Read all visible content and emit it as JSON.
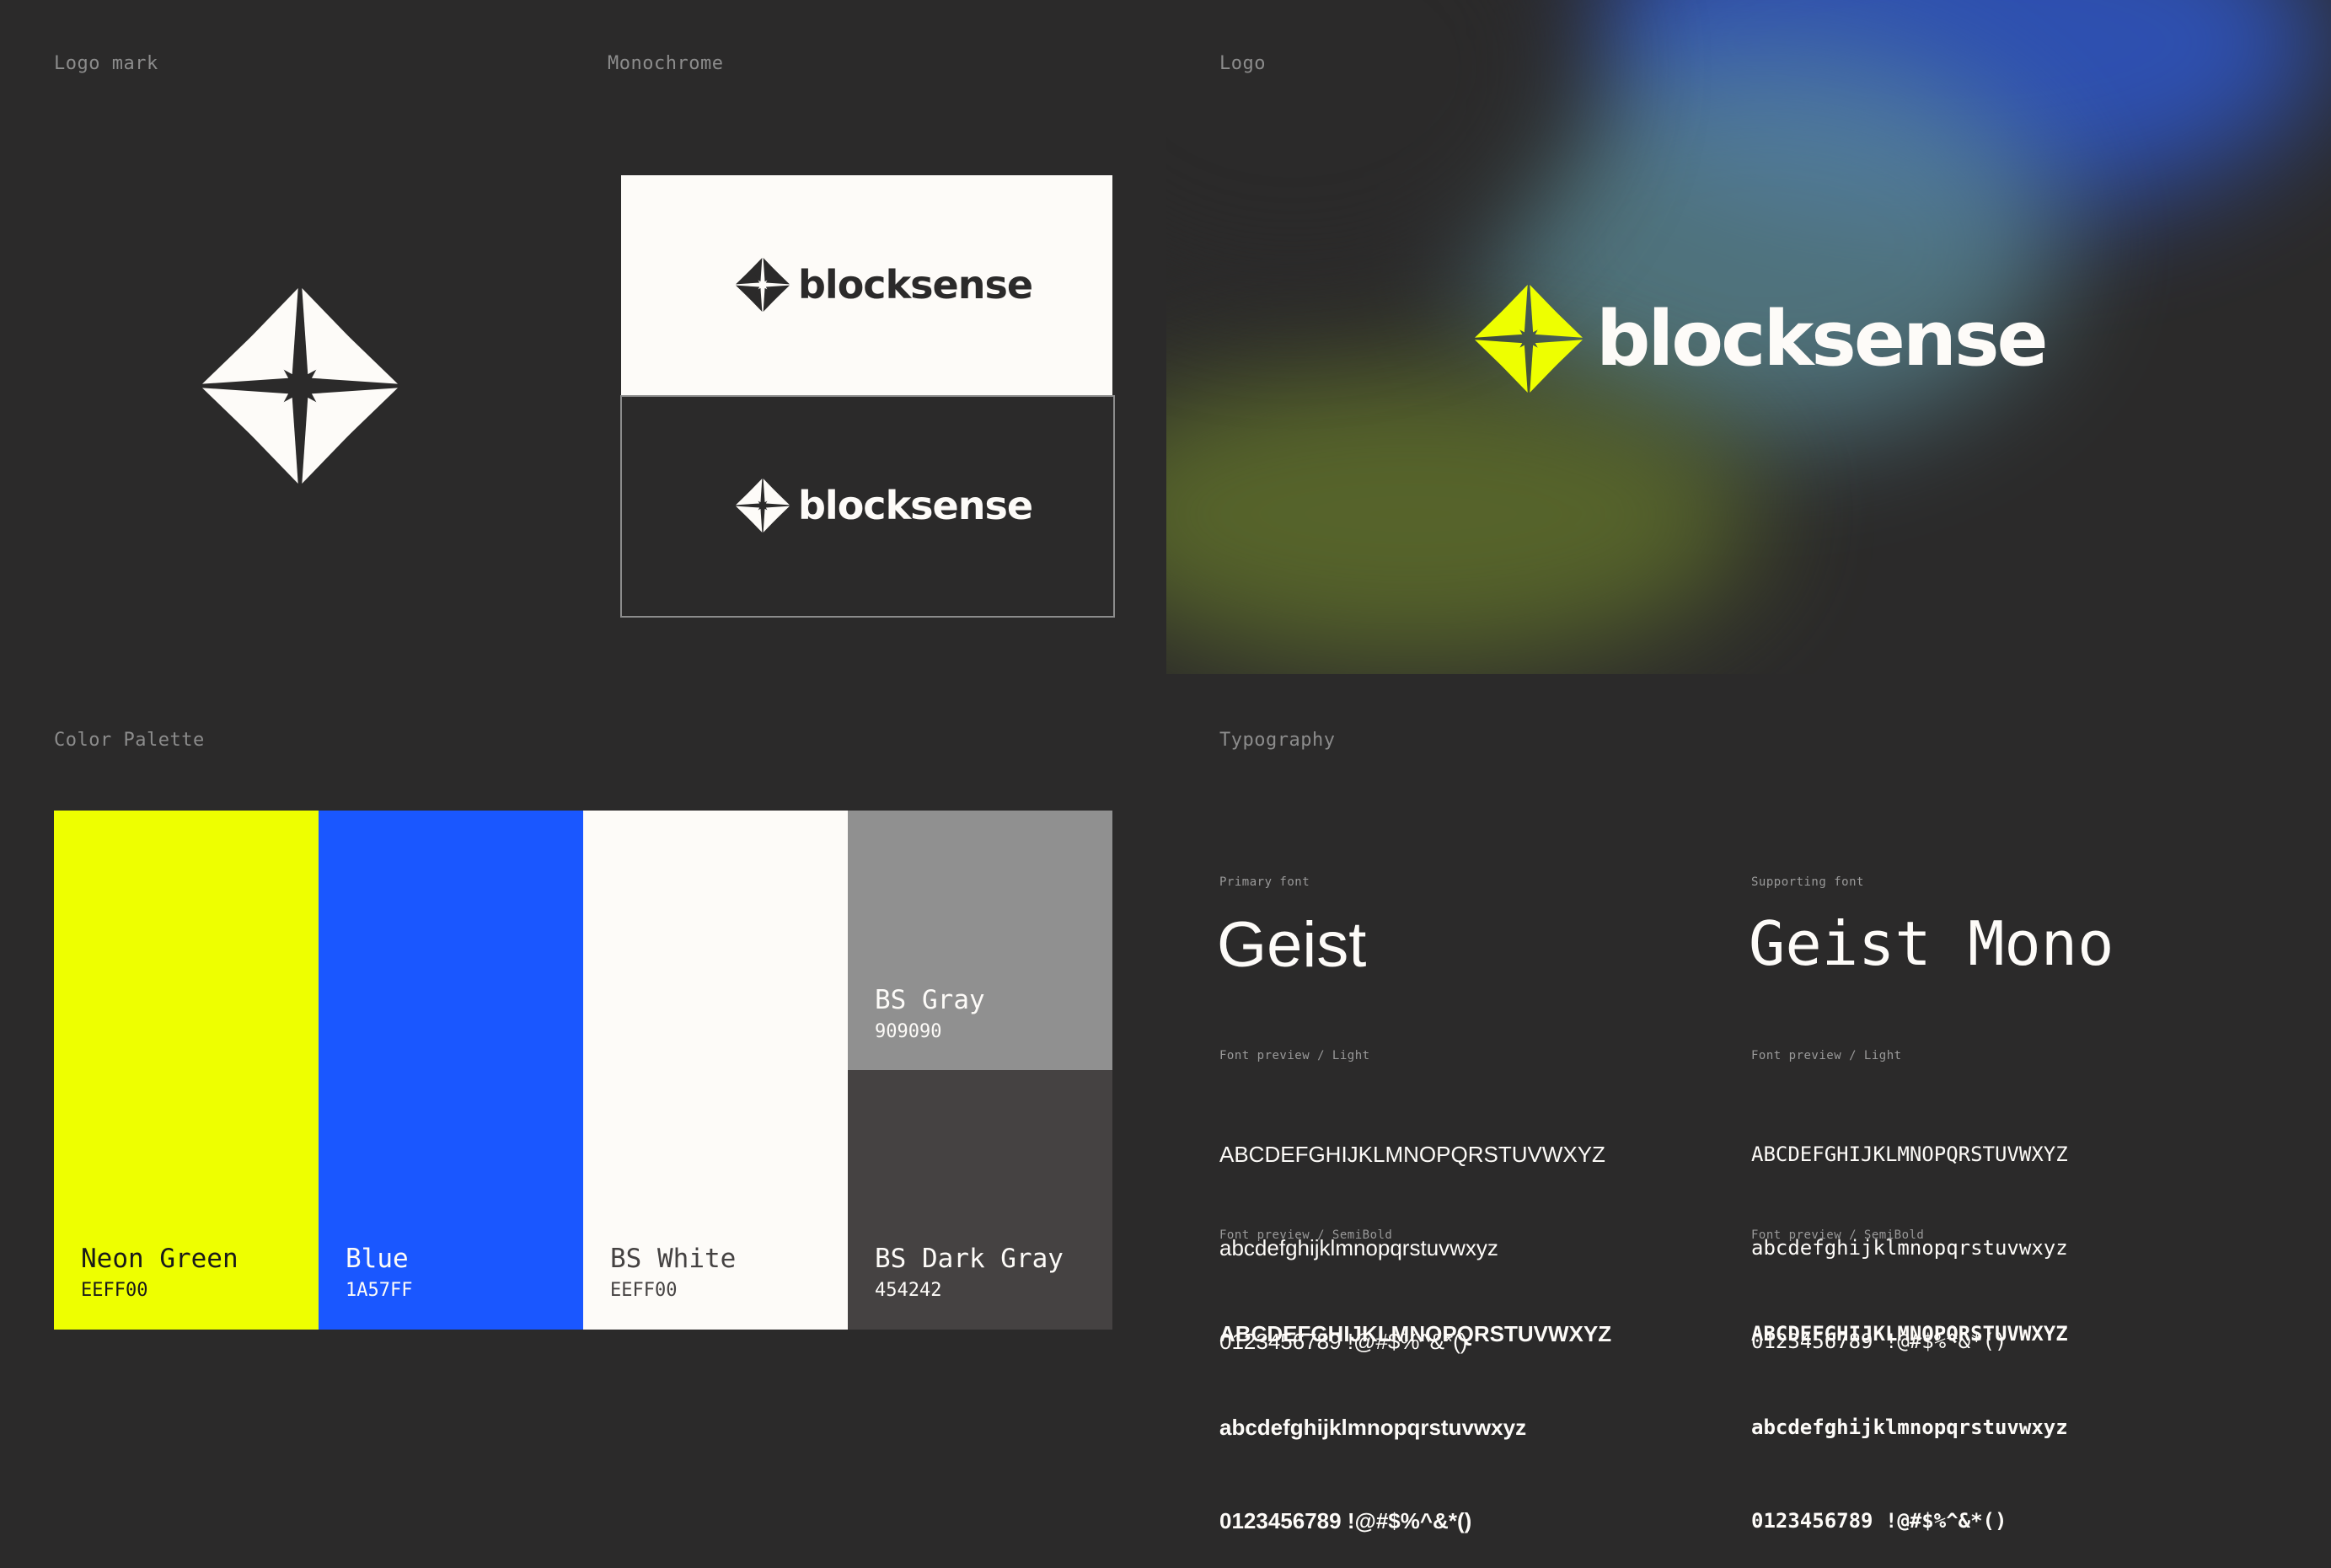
{
  "sections": {
    "logo_mark": "Logo mark",
    "monochrome": "Monochrome",
    "logo": "Logo",
    "color_palette": "Color Palette",
    "typography": "Typography"
  },
  "brand": {
    "wordmark": "blocksense"
  },
  "colors_accent": {
    "neon": "#EEFF00",
    "blue": "#1A57FF"
  },
  "palette": [
    {
      "name": "Neon Green",
      "hex": "EEFF00",
      "color": "#EEFF00",
      "text_color": "#1a1a1a"
    },
    {
      "name": "Blue",
      "hex": "1A57FF",
      "color": "#1A57FF",
      "text_color": "#fdfbf8"
    },
    {
      "name": "BS White",
      "hex": "EEFF00",
      "color": "#FDFBF8",
      "text_color": "#454242"
    },
    {
      "name": "BS Gray",
      "hex": "909090",
      "color": "#909090",
      "text_color": "#fdfbf8"
    },
    {
      "name": "BS Dark Gray",
      "hex": "454242",
      "color": "#454242",
      "text_color": "#fdfbf8"
    }
  ],
  "typography": {
    "primary": {
      "label": "Primary font",
      "name": "Geist",
      "preview_light_label": "Font preview / Light",
      "preview_light": [
        "ABCDEFGHIJKLMNOPQRSTUVWXYZ",
        "abcdefghijklmnopqrstuvwxyz",
        "0123456789 !@#$%^&*()"
      ],
      "preview_semibold_label": "Font preview / SemiBold",
      "preview_semibold": [
        "ABCDEFGHIJKLMNOPQRSTUVWXYZ",
        "abcdefghijklmnopqrstuvwxyz",
        "0123456789 !@#$%^&*()"
      ]
    },
    "supporting": {
      "label": "Supporting font",
      "name": "Geist Mono",
      "preview_light_label": "Font preview / Light",
      "preview_light": [
        "ABCDEFGHIJKLMNOPQRSTUVWXYZ",
        "abcdefghijklmnopqrstuvwxyz",
        "0123456789 !@#$%^&*()"
      ],
      "preview_semibold_label": "Font preview / SemiBold",
      "preview_semibold": [
        "ABCDEFGHIJKLMNOPQRSTUVWXYZ",
        "abcdefghijklmnopqrstuvwxyz",
        "0123456789 !@#$%^&*()"
      ]
    }
  }
}
